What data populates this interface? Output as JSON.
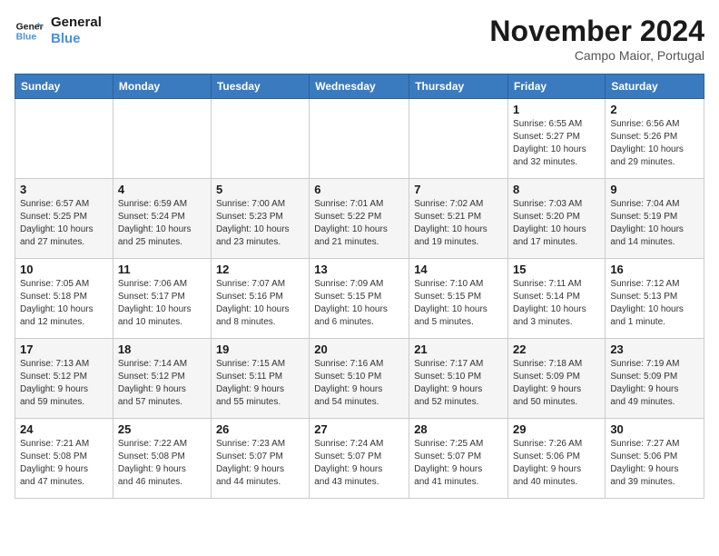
{
  "header": {
    "logo_line1": "General",
    "logo_line2": "Blue",
    "month": "November 2024",
    "location": "Campo Maior, Portugal"
  },
  "weekdays": [
    "Sunday",
    "Monday",
    "Tuesday",
    "Wednesday",
    "Thursday",
    "Friday",
    "Saturday"
  ],
  "weeks": [
    [
      {
        "day": "",
        "info": ""
      },
      {
        "day": "",
        "info": ""
      },
      {
        "day": "",
        "info": ""
      },
      {
        "day": "",
        "info": ""
      },
      {
        "day": "",
        "info": ""
      },
      {
        "day": "1",
        "info": "Sunrise: 6:55 AM\nSunset: 5:27 PM\nDaylight: 10 hours\nand 32 minutes."
      },
      {
        "day": "2",
        "info": "Sunrise: 6:56 AM\nSunset: 5:26 PM\nDaylight: 10 hours\nand 29 minutes."
      }
    ],
    [
      {
        "day": "3",
        "info": "Sunrise: 6:57 AM\nSunset: 5:25 PM\nDaylight: 10 hours\nand 27 minutes."
      },
      {
        "day": "4",
        "info": "Sunrise: 6:59 AM\nSunset: 5:24 PM\nDaylight: 10 hours\nand 25 minutes."
      },
      {
        "day": "5",
        "info": "Sunrise: 7:00 AM\nSunset: 5:23 PM\nDaylight: 10 hours\nand 23 minutes."
      },
      {
        "day": "6",
        "info": "Sunrise: 7:01 AM\nSunset: 5:22 PM\nDaylight: 10 hours\nand 21 minutes."
      },
      {
        "day": "7",
        "info": "Sunrise: 7:02 AM\nSunset: 5:21 PM\nDaylight: 10 hours\nand 19 minutes."
      },
      {
        "day": "8",
        "info": "Sunrise: 7:03 AM\nSunset: 5:20 PM\nDaylight: 10 hours\nand 17 minutes."
      },
      {
        "day": "9",
        "info": "Sunrise: 7:04 AM\nSunset: 5:19 PM\nDaylight: 10 hours\nand 14 minutes."
      }
    ],
    [
      {
        "day": "10",
        "info": "Sunrise: 7:05 AM\nSunset: 5:18 PM\nDaylight: 10 hours\nand 12 minutes."
      },
      {
        "day": "11",
        "info": "Sunrise: 7:06 AM\nSunset: 5:17 PM\nDaylight: 10 hours\nand 10 minutes."
      },
      {
        "day": "12",
        "info": "Sunrise: 7:07 AM\nSunset: 5:16 PM\nDaylight: 10 hours\nand 8 minutes."
      },
      {
        "day": "13",
        "info": "Sunrise: 7:09 AM\nSunset: 5:15 PM\nDaylight: 10 hours\nand 6 minutes."
      },
      {
        "day": "14",
        "info": "Sunrise: 7:10 AM\nSunset: 5:15 PM\nDaylight: 10 hours\nand 5 minutes."
      },
      {
        "day": "15",
        "info": "Sunrise: 7:11 AM\nSunset: 5:14 PM\nDaylight: 10 hours\nand 3 minutes."
      },
      {
        "day": "16",
        "info": "Sunrise: 7:12 AM\nSunset: 5:13 PM\nDaylight: 10 hours\nand 1 minute."
      }
    ],
    [
      {
        "day": "17",
        "info": "Sunrise: 7:13 AM\nSunset: 5:12 PM\nDaylight: 9 hours\nand 59 minutes."
      },
      {
        "day": "18",
        "info": "Sunrise: 7:14 AM\nSunset: 5:12 PM\nDaylight: 9 hours\nand 57 minutes."
      },
      {
        "day": "19",
        "info": "Sunrise: 7:15 AM\nSunset: 5:11 PM\nDaylight: 9 hours\nand 55 minutes."
      },
      {
        "day": "20",
        "info": "Sunrise: 7:16 AM\nSunset: 5:10 PM\nDaylight: 9 hours\nand 54 minutes."
      },
      {
        "day": "21",
        "info": "Sunrise: 7:17 AM\nSunset: 5:10 PM\nDaylight: 9 hours\nand 52 minutes."
      },
      {
        "day": "22",
        "info": "Sunrise: 7:18 AM\nSunset: 5:09 PM\nDaylight: 9 hours\nand 50 minutes."
      },
      {
        "day": "23",
        "info": "Sunrise: 7:19 AM\nSunset: 5:09 PM\nDaylight: 9 hours\nand 49 minutes."
      }
    ],
    [
      {
        "day": "24",
        "info": "Sunrise: 7:21 AM\nSunset: 5:08 PM\nDaylight: 9 hours\nand 47 minutes."
      },
      {
        "day": "25",
        "info": "Sunrise: 7:22 AM\nSunset: 5:08 PM\nDaylight: 9 hours\nand 46 minutes."
      },
      {
        "day": "26",
        "info": "Sunrise: 7:23 AM\nSunset: 5:07 PM\nDaylight: 9 hours\nand 44 minutes."
      },
      {
        "day": "27",
        "info": "Sunrise: 7:24 AM\nSunset: 5:07 PM\nDaylight: 9 hours\nand 43 minutes."
      },
      {
        "day": "28",
        "info": "Sunrise: 7:25 AM\nSunset: 5:07 PM\nDaylight: 9 hours\nand 41 minutes."
      },
      {
        "day": "29",
        "info": "Sunrise: 7:26 AM\nSunset: 5:06 PM\nDaylight: 9 hours\nand 40 minutes."
      },
      {
        "day": "30",
        "info": "Sunrise: 7:27 AM\nSunset: 5:06 PM\nDaylight: 9 hours\nand 39 minutes."
      }
    ]
  ]
}
